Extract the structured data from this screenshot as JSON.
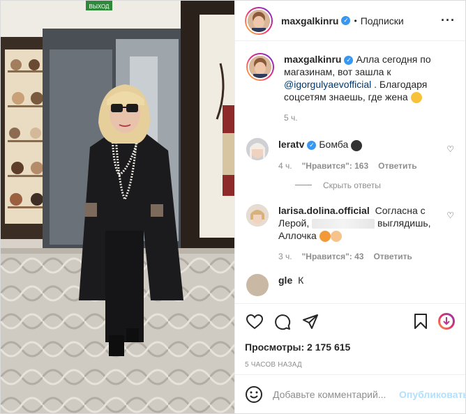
{
  "post": {
    "author": "maxgalkinru",
    "follow_label": "Подписки",
    "caption_user": "maxgalkinru",
    "caption_part1": "Алла сегодня по магазинам, вот зашла к",
    "caption_mention": "@igorgulyaevofficial",
    "caption_part2": ". Благодаря соцсетям знаешь, где жена",
    "caption_time": "5 ч.",
    "shop_sign": "ВЫХОД"
  },
  "comments": [
    {
      "user": "leratv",
      "text": "Бомба",
      "time": "4 ч.",
      "likes": "\"Нравится\": 163",
      "reply": "Ответить",
      "hide_replies": "Скрыть ответы"
    },
    {
      "user": "larisa.dolina.official",
      "text_part1": "Согласна с Лерой,",
      "text_part2": "выглядишь, Аллочка",
      "time": "3 ч.",
      "likes": "\"Нравится\": 43",
      "reply": "Ответить"
    },
    {
      "user": "gle",
      "text": "К"
    }
  ],
  "stats": {
    "views": "Просмотры: 2 175 615",
    "ago": "5 ЧАСОВ НАЗАД"
  },
  "add_comment": {
    "placeholder": "Добавьте комментарий...",
    "publish": "Опубликовать"
  },
  "colors": {
    "verified": "#3897f0",
    "mention": "#00376b",
    "muted": "#8e8e8e",
    "publish_disabled": "#b2dffc"
  }
}
